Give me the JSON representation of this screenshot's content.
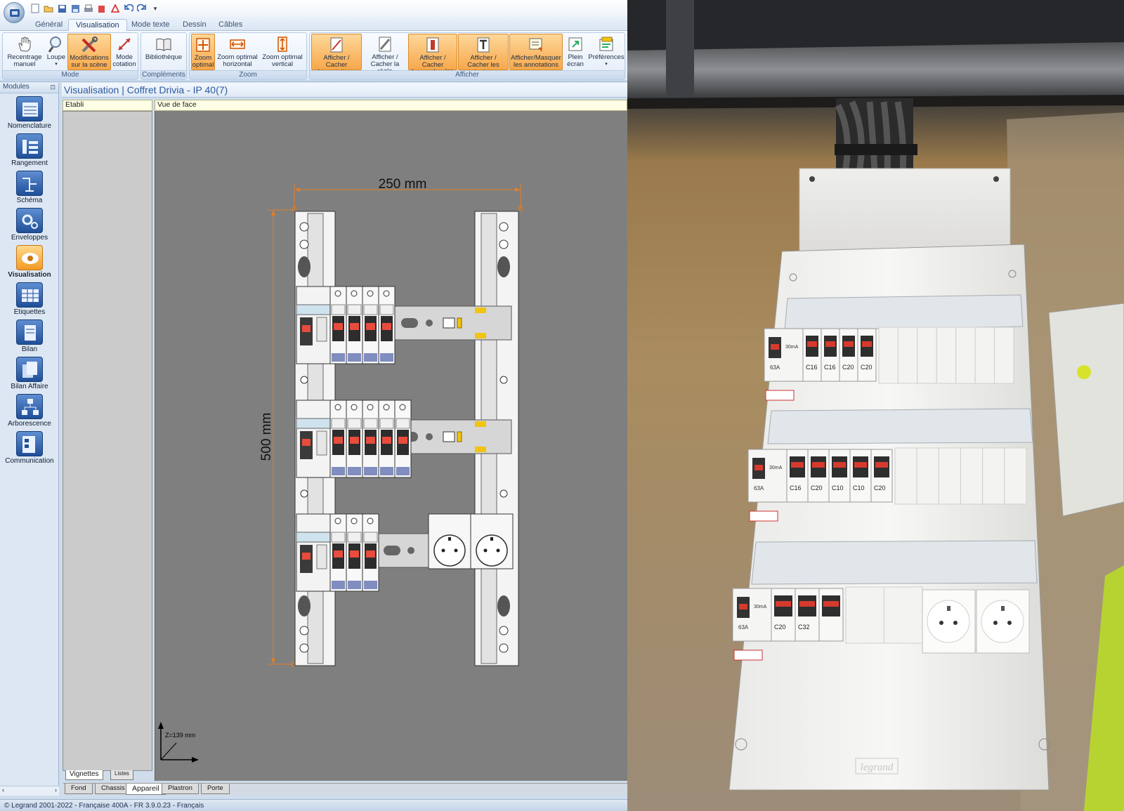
{
  "ribbon": {
    "tabs": [
      "Général",
      "Visualisation",
      "Mode texte",
      "Dessin",
      "Câbles"
    ],
    "active_tab": "Visualisation",
    "groups": {
      "mode": {
        "label": "Mode",
        "buttons": [
          {
            "label": "Recentrage\nmanuel",
            "icon": "hand-icon"
          },
          {
            "label": "Loupe",
            "icon": "magnifier-icon"
          },
          {
            "label": "Modifications\nsur la scène",
            "icon": "tools-icon"
          },
          {
            "label": "Mode\ncotation",
            "icon": "dimension-icon"
          }
        ]
      },
      "complements": {
        "label": "Compléments",
        "buttons": [
          {
            "label": "Bibliothèque",
            "icon": "book-icon"
          }
        ]
      },
      "zoom": {
        "label": "Zoom",
        "buttons": [
          {
            "label": "Zoom\noptimal",
            "icon": "zoom-fit-icon"
          },
          {
            "label": "Zoom optimal\nhorizontal",
            "icon": "zoom-horizontal-icon"
          },
          {
            "label": "Zoom optimal\nvertical",
            "icon": "zoom-vertical-icon"
          }
        ]
      },
      "afficher": {
        "label": "Afficher",
        "buttons": [
          {
            "label": "Afficher / Cacher\nles cotations",
            "icon": "cotations-icon"
          },
          {
            "label": "Afficher /\nCacher la règle",
            "icon": "ruler-icon"
          },
          {
            "label": "Afficher / Cacher\nla vue de côté",
            "icon": "side-view-icon"
          },
          {
            "label": "Afficher /\nCacher les textes",
            "icon": "text-icon"
          },
          {
            "label": "Afficher/Masquer\nles annotations",
            "icon": "annotation-icon"
          },
          {
            "label": "Plein\nécran",
            "icon": "fullscreen-icon"
          },
          {
            "label": "Préférences",
            "icon": "preferences-icon"
          }
        ]
      }
    }
  },
  "modules": {
    "title": "Modules",
    "items": [
      {
        "label": "Nomenclature",
        "icon": "nomenclature-icon"
      },
      {
        "label": "Rangement",
        "icon": "rangement-icon"
      },
      {
        "label": "Schéma",
        "icon": "schema-icon"
      },
      {
        "label": "Enveloppes",
        "icon": "gears-icon"
      },
      {
        "label": "Visualisation",
        "icon": "eye-icon"
      },
      {
        "label": "Etiquettes",
        "icon": "labels-icon"
      },
      {
        "label": "Bilan",
        "icon": "document-icon"
      },
      {
        "label": "Bilan Affaire",
        "icon": "documents-icon"
      },
      {
        "label": "Arborescence",
        "icon": "tree-icon"
      },
      {
        "label": "Communication",
        "icon": "communication-icon"
      }
    ],
    "selected": "Visualisation"
  },
  "workspace": {
    "title": "Visualisation | Coffret Drivia - IP 40(7)",
    "etabli_label": "Etabli",
    "view_label": "Vue de face",
    "dimension_width": "250 mm",
    "dimension_height": "500 mm",
    "axis_label": "Z=139 mm",
    "side_tabs": [
      "Vignettes",
      "Listes"
    ],
    "bottom_tabs": [
      "Fond",
      "Chassis",
      "Appareil",
      "Plastron",
      "Porte"
    ],
    "active_bottom_tab": "Appareil"
  },
  "status": {
    "text": "© Legrand 2001-2022 - Française 400A - FR 3.9.0.23 - Français"
  },
  "photo": {
    "brand": "legrand",
    "breaker_labels": [
      "C16",
      "C16",
      "C20",
      "C20",
      "C16",
      "C20",
      "C10",
      "C10",
      "C20",
      "C20",
      "C32"
    ],
    "rcd_labels": [
      "63A",
      "63A",
      "63A"
    ],
    "rcd_rating": "30mA"
  },
  "colors": {
    "accent_orange": "#f7a545",
    "ribbon_blue": "#dbe6f3",
    "canvas_gray": "#7f7f7f",
    "title_blue": "#2c5aa0"
  }
}
